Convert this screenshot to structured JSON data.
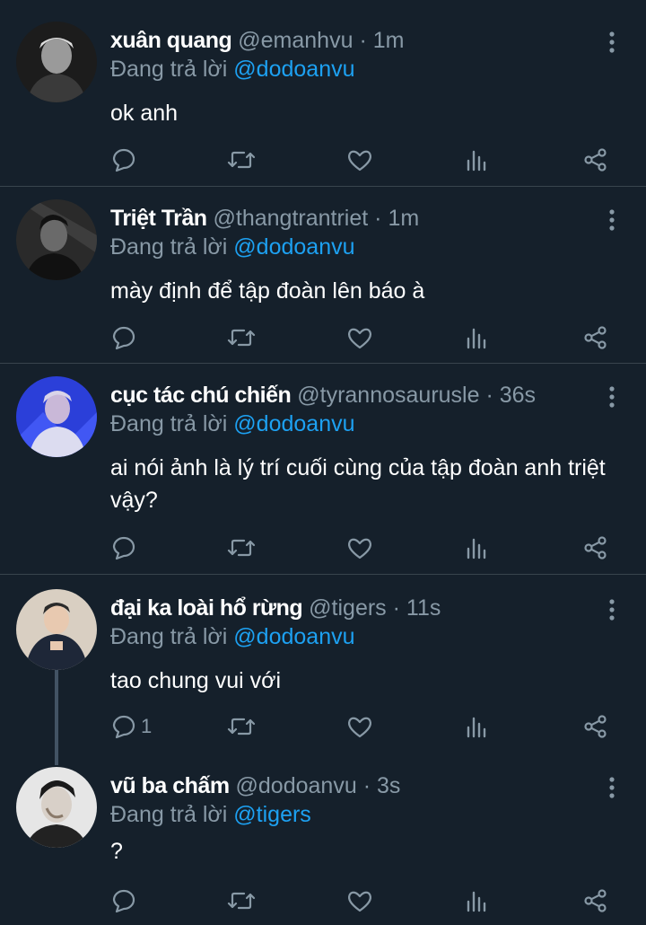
{
  "tweets": [
    {
      "name": "xuân quang",
      "handle": "@emanhvu",
      "separator": "·",
      "time": "1m",
      "reply_prefix": "Đang trả lời",
      "reply_to": "@dodoanvu",
      "text": "ok anh",
      "reply_count": ""
    },
    {
      "name": "Triệt Trần",
      "handle": "@thangtrantriet",
      "separator": "·",
      "time": "1m",
      "reply_prefix": "Đang trả lời",
      "reply_to": "@dodoanvu",
      "text": "mày định để tập đoàn lên báo à",
      "reply_count": ""
    },
    {
      "name": "cục tác chú chiến",
      "handle": "@tyrannosaurusle",
      "separator": "·",
      "time": "36s",
      "reply_prefix": "Đang trả lời",
      "reply_to": "@dodoanvu",
      "text": "ai nói ảnh là lý trí cuối cùng của tập đoàn anh triệt vậy?",
      "reply_count": ""
    },
    {
      "name": "đại ka loài hổ rừng",
      "handle": "@tigers",
      "separator": "·",
      "time": "11s",
      "reply_prefix": "Đang trả lời",
      "reply_to": "@dodoanvu",
      "text": "tao chung vui với",
      "reply_count": "1"
    },
    {
      "name": "vũ ba chấm",
      "handle": "@dodoanvu",
      "separator": "·",
      "time": "3s",
      "reply_prefix": "Đang trả lời",
      "reply_to": "@tigers",
      "text": "?",
      "reply_count": ""
    }
  ],
  "icons": {
    "reply": "reply-icon",
    "retweet": "retweet-icon",
    "like": "heart-icon",
    "analytics": "analytics-icon",
    "share": "share-icon",
    "more": "more-vertical-icon"
  },
  "colors": {
    "background": "#15202b",
    "divider": "#38444d",
    "muted": "#8899a6",
    "mention": "#1da1f2"
  }
}
